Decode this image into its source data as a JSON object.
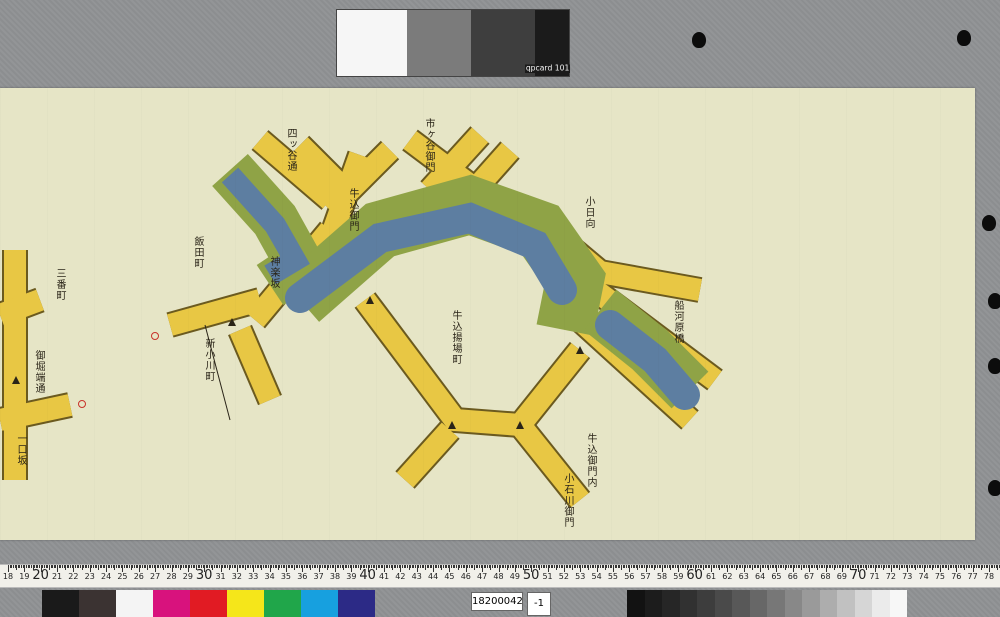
{
  "gray_card": {
    "brand": "qpcard 101"
  },
  "document": {
    "id": "18200042",
    "sheet": "-1"
  },
  "ruler": {
    "numbers": [
      "18",
      "19",
      "20",
      "21",
      "22",
      "23",
      "24",
      "25",
      "26",
      "27",
      "28",
      "29",
      "30",
      "31",
      "32",
      "33",
      "34",
      "35",
      "36",
      "37",
      "38",
      "39",
      "40",
      "41",
      "42",
      "43",
      "44",
      "45",
      "46",
      "47",
      "48",
      "49",
      "50",
      "51",
      "52",
      "53",
      "54",
      "55",
      "56",
      "57",
      "58",
      "59",
      "60",
      "61",
      "62",
      "63",
      "64",
      "65",
      "66",
      "67",
      "68",
      "69",
      "70",
      "71",
      "72",
      "73",
      "74",
      "75",
      "76",
      "77",
      "78"
    ]
  },
  "colors": {
    "paper": "#e6e5c6",
    "road": "#e8c744",
    "green_bank": "#8fa346",
    "water": "#5d7ea1",
    "swatches": [
      "#1a1a1a",
      "#3b3332",
      "#f4f4f4",
      "#d8127d",
      "#e11b23",
      "#f5e61a",
      "#20a64a",
      "#17a0df",
      "#2c2a86"
    ],
    "grays": [
      "#121212",
      "#1c1c1c",
      "#262626",
      "#313131",
      "#3d3d3d",
      "#4a4a4a",
      "#585858",
      "#676767",
      "#777777",
      "#888888",
      "#9a9a9a",
      "#adadad",
      "#c1c1c1",
      "#d6d6d6",
      "#ebebeb",
      "#f7f7f7"
    ]
  },
  "map": {
    "labels": [
      {
        "id": "upper-road-1",
        "text": "四ッ谷通"
      },
      {
        "id": "upper-road-2",
        "text": "牛込御門"
      },
      {
        "id": "upper-road-3",
        "text": "市ヶ谷御門"
      },
      {
        "id": "right-area",
        "text": "小日向"
      },
      {
        "id": "east-bridge",
        "text": "船河原橋"
      },
      {
        "id": "central-road",
        "text": "牛込揚場町"
      },
      {
        "id": "left-top",
        "text": "飯田町"
      },
      {
        "id": "left-mid",
        "text": "神楽坂"
      },
      {
        "id": "lower-mid",
        "text": "新小川町"
      },
      {
        "id": "lower-right",
        "text": "牛込御門内"
      },
      {
        "id": "bottom-road",
        "text": "小石川御門"
      },
      {
        "id": "far-left-1",
        "text": "三番町"
      },
      {
        "id": "far-left-2",
        "text": "御堀端通"
      },
      {
        "id": "far-left-3",
        "text": "一口坂"
      }
    ]
  }
}
